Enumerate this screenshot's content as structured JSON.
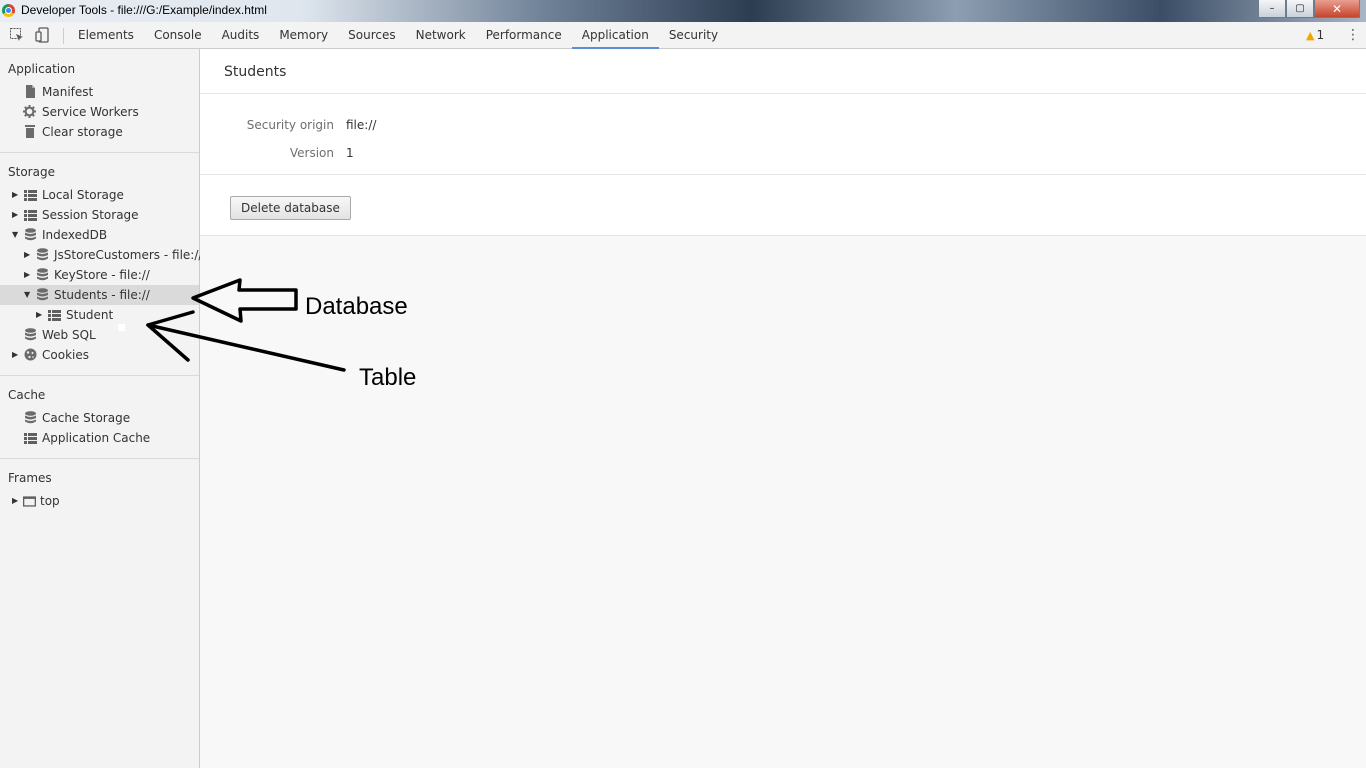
{
  "window": {
    "title": "Developer Tools - file:///G:/Example/index.html",
    "controls": {
      "minimize": "–",
      "maximize": "▢",
      "close": "✕"
    }
  },
  "toolbar": {
    "tabs": [
      {
        "label": "Elements"
      },
      {
        "label": "Console"
      },
      {
        "label": "Audits"
      },
      {
        "label": "Memory"
      },
      {
        "label": "Sources"
      },
      {
        "label": "Network"
      },
      {
        "label": "Performance"
      },
      {
        "label": "Application",
        "active": true
      },
      {
        "label": "Security"
      }
    ],
    "warning_count": "1",
    "warning_icon": "warning-icon",
    "accent_color": "#5a8fd6"
  },
  "sidebar": {
    "application": {
      "title": "Application",
      "items": [
        {
          "label": "Manifest",
          "icon": "document-icon"
        },
        {
          "label": "Service Workers",
          "icon": "gear-icon"
        },
        {
          "label": "Clear storage",
          "icon": "trash-icon"
        }
      ]
    },
    "storage": {
      "title": "Storage",
      "items": [
        {
          "label": "Local Storage",
          "icon": "grid-icon"
        },
        {
          "label": "Session Storage",
          "icon": "grid-icon"
        },
        {
          "label": "IndexedDB",
          "icon": "database-icon"
        },
        {
          "label": "JsStoreCustomers - file://",
          "icon": "database-icon"
        },
        {
          "label": "KeyStore - file://",
          "icon": "database-icon"
        },
        {
          "label": "Students - file://",
          "icon": "database-icon",
          "selected": true
        },
        {
          "label": "Student",
          "icon": "grid-icon"
        },
        {
          "label": "Web SQL",
          "icon": "database-icon"
        },
        {
          "label": "Cookies",
          "icon": "cookie-icon"
        }
      ]
    },
    "cache": {
      "title": "Cache",
      "items": [
        {
          "label": "Cache Storage",
          "icon": "database-icon"
        },
        {
          "label": "Application Cache",
          "icon": "grid-icon"
        }
      ]
    },
    "frames": {
      "title": "Frames",
      "items": [
        {
          "label": "top",
          "icon": "frame-icon"
        }
      ]
    }
  },
  "main": {
    "title": "Students",
    "security_origin_label": "Security origin",
    "security_origin_value": "file://",
    "version_label": "Version",
    "version_value": "1",
    "delete_button": "Delete database"
  },
  "annotations": {
    "database_label": "Database",
    "table_label": "Table"
  }
}
